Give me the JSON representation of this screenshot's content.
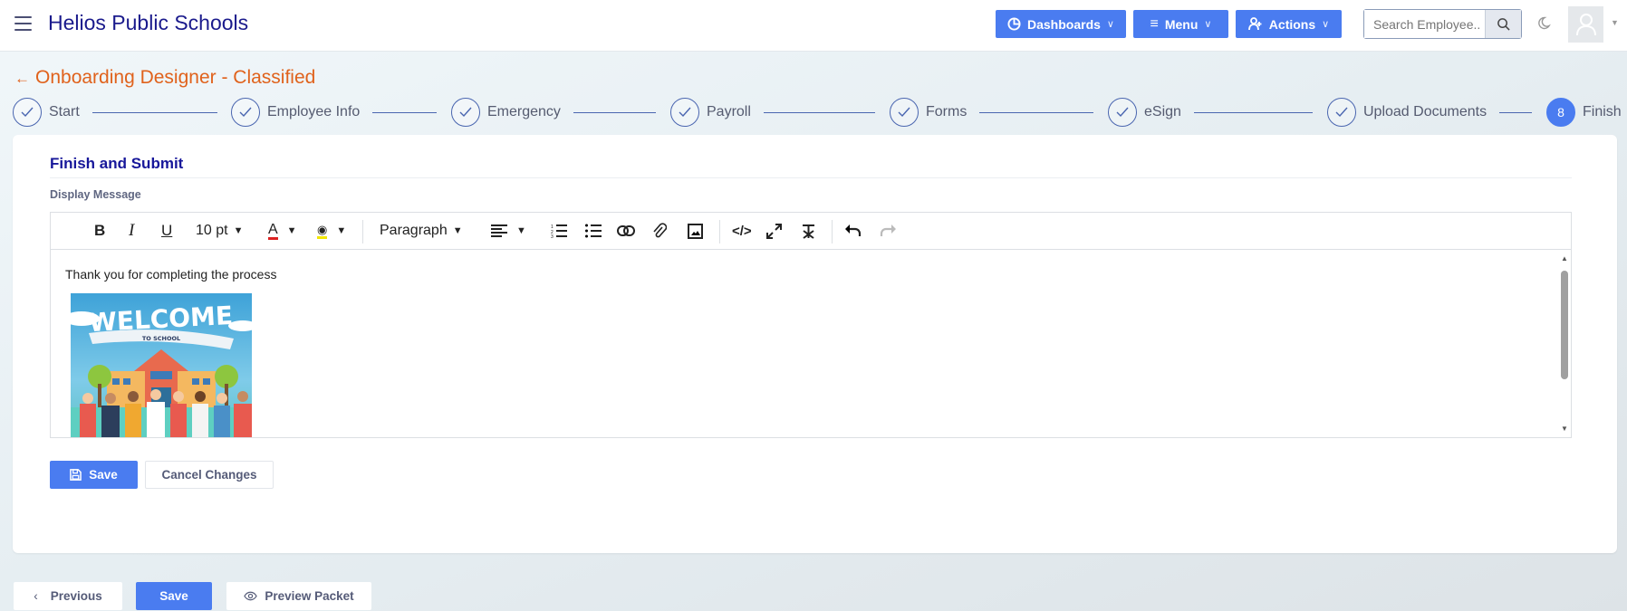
{
  "header": {
    "brand": "Helios Public Schools",
    "dashboards": "Dashboards",
    "menu": "Menu",
    "actions": "Actions",
    "search_placeholder": "Search Employee.."
  },
  "page": {
    "title": "Onboarding Designer - Classified"
  },
  "steps": [
    {
      "label": "Start",
      "status": "done"
    },
    {
      "label": "Employee Info",
      "status": "done"
    },
    {
      "label": "Emergency",
      "status": "done"
    },
    {
      "label": "Payroll",
      "status": "done"
    },
    {
      "label": "Forms",
      "status": "done"
    },
    {
      "label": "eSign",
      "status": "done"
    },
    {
      "label": "Upload Documents",
      "status": "done"
    },
    {
      "label": "Finish",
      "status": "active",
      "number": "8"
    }
  ],
  "section": {
    "title": "Finish and Submit",
    "field_label": "Display Message"
  },
  "editor": {
    "font_size": "10 pt",
    "block_format": "Paragraph",
    "message": "Thank you for completing the process",
    "image_text": {
      "main": "WELCOME",
      "sub": "TO SCHOOL"
    }
  },
  "form_buttons": {
    "save": "Save",
    "cancel": "Cancel Changes"
  },
  "footer": {
    "previous": "Previous",
    "save": "Save",
    "preview": "Preview Packet"
  },
  "colors": {
    "primary": "#4a7cf0",
    "title": "#e0621c",
    "brand": "#1a1a8c"
  }
}
